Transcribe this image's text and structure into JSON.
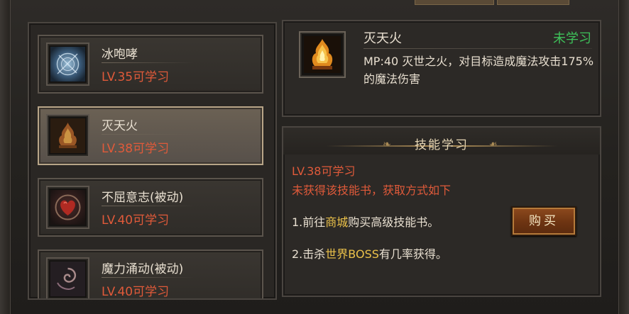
{
  "skill_list": [
    {
      "name": "冰咆哮",
      "level": "LV.35可学习",
      "icon": "ice-roar-icon",
      "selected": false
    },
    {
      "name": "灭天火",
      "level": "LV.38可学习",
      "icon": "fire-icon",
      "selected": true
    },
    {
      "name": "不屈意志(被动)",
      "level": "LV.40可学习",
      "icon": "heart-icon",
      "selected": false
    },
    {
      "name": "魔力涌动(被动)",
      "level": "LV.40可学习",
      "icon": "swirl-icon",
      "selected": false
    }
  ],
  "detail": {
    "name": "灭天火",
    "status": "未学习",
    "description": "MP:40  灭世之火，对目标造成魔法攻击175%的魔法伤害"
  },
  "learn": {
    "title": "技能学习",
    "level_req": "LV.38可学习",
    "missing_book": "未获得该技能书，获取方式如下",
    "option1_prefix": "1.前往",
    "option1_highlight": "商城",
    "option1_suffix": "购买高级技能书。",
    "option2_prefix": "2.击杀",
    "option2_highlight": "世界BOSS",
    "option2_suffix": "有几率获得。",
    "buy_label": "购买"
  },
  "colors": {
    "level_text": "#e05a3a",
    "status_unlearned": "#3ec25a",
    "highlight": "#ecc24a"
  }
}
